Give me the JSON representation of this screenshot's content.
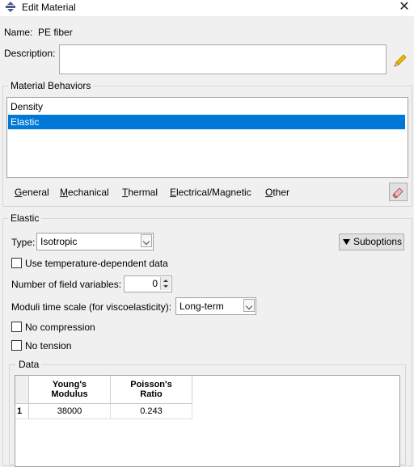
{
  "window": {
    "title": "Edit Material",
    "close_glyph": "✕"
  },
  "name": {
    "label": "Name:",
    "value": "PE fiber"
  },
  "description": {
    "label": "Description:",
    "value": ""
  },
  "behaviors": {
    "title": "Material Behaviors",
    "items": [
      {
        "label": "Density",
        "selected": false
      },
      {
        "label": "Elastic",
        "selected": true
      }
    ]
  },
  "menu": [
    {
      "label": "General",
      "mnemonic": "G"
    },
    {
      "label": "Mechanical",
      "mnemonic": "M"
    },
    {
      "label": "Thermal",
      "mnemonic": "T"
    },
    {
      "label": "Electrical/Magnetic",
      "mnemonic": "E"
    },
    {
      "label": "Other",
      "mnemonic": "O"
    }
  ],
  "elastic": {
    "title": "Elastic",
    "type_label": "Type:",
    "type_value": "Isotropic",
    "suboptions_label": "Suboptions",
    "temp_dependent_label": "Use temperature-dependent data",
    "temp_dependent_checked": false,
    "field_vars_label": "Number of field variables:",
    "field_vars_value": "0",
    "moduli_label": "Moduli time scale (for viscoelasticity):",
    "moduli_value": "Long-term",
    "no_compression_label": "No compression",
    "no_compression_checked": false,
    "no_tension_label": "No tension",
    "no_tension_checked": false
  },
  "data": {
    "title": "Data",
    "columns": [
      [
        "Young's",
        "Modulus"
      ],
      [
        "Poisson's",
        "Ratio"
      ]
    ],
    "rows": [
      {
        "index": "1",
        "values": [
          "38000",
          "0.243"
        ]
      }
    ]
  },
  "colors": {
    "selection": "#0078d7",
    "window_bg": "#f0f0f0"
  }
}
